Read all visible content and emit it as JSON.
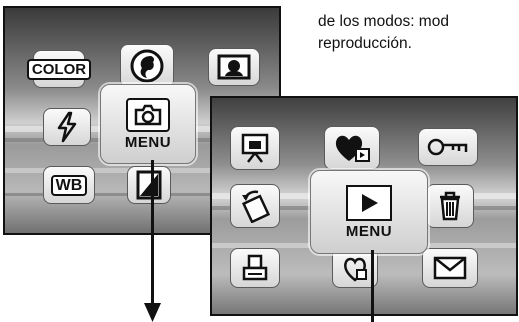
{
  "caption": {
    "line1": "de los modos: mod",
    "line2": "reproducción."
  },
  "screen_record": {
    "icons": [
      "color-mode-icon",
      "portrait-icon",
      "landscape-preview-icon",
      "flash-icon",
      "camera-icon",
      "wb-icon",
      "exposure-icon"
    ],
    "color_label": "COLOR",
    "wb_label": "WB",
    "menu_label": "MENU"
  },
  "screen_playback": {
    "icons": [
      "slideshow-icon",
      "favorite-icon",
      "protect-key-icon",
      "rotate-icon",
      "playback-icon",
      "delete-icon",
      "print-icon",
      "dpof-icon",
      "email-icon"
    ],
    "menu_label": "MENU"
  },
  "colors": {
    "ink": "#111111",
    "icon_face": "#e8e8e8"
  }
}
